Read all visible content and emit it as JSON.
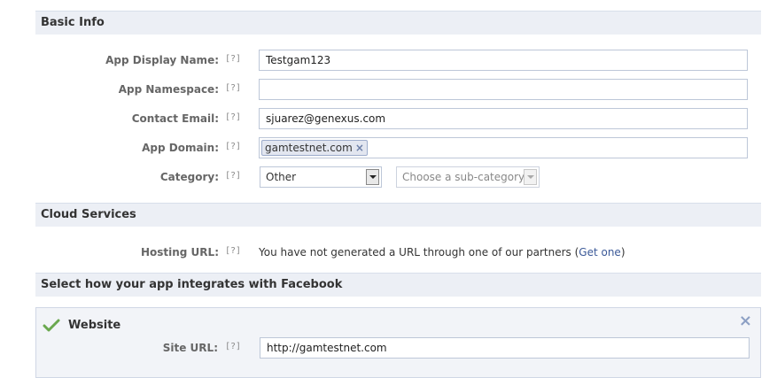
{
  "help_marker": "[?]",
  "basic_info": {
    "title": "Basic Info",
    "display_name": {
      "label": "App Display Name:",
      "value": "Testgam123"
    },
    "namespace": {
      "label": "App Namespace:",
      "value": ""
    },
    "contact_email": {
      "label": "Contact Email:",
      "value": "sjuarez@genexus.com"
    },
    "app_domain": {
      "label": "App Domain:",
      "token": "gamtestnet.com",
      "remove": "×"
    },
    "category": {
      "label": "Category:",
      "selected": "Other",
      "sub_placeholder": "Choose a sub-category"
    }
  },
  "cloud_services": {
    "title": "Cloud Services",
    "hosting": {
      "label": "Hosting URL:",
      "text": "You have not generated a URL through one of our partners (",
      "link": "Get one",
      "close": ")"
    }
  },
  "integrations": {
    "title": "Select how your app integrates with Facebook",
    "website": {
      "title": "Website",
      "close": "×",
      "site_url_label": "Site URL:",
      "site_url_value": "http://gamtestnet.com"
    }
  },
  "colors": {
    "link": "#3b5998",
    "check": "#6aa84f",
    "section_bg": "#eceff5"
  }
}
